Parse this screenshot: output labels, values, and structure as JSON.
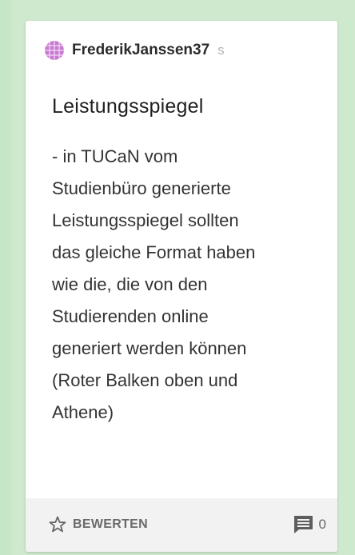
{
  "card": {
    "author": {
      "name": "FrederikJanssen37",
      "suffix": "s",
      "avatar_icon": "avatar-pattern-icon"
    },
    "title": "Leistungsspiegel",
    "body_lines": [
      "- in TUCaN vom",
      "Studienbüro generierte",
      "Leistungsspiegel sollten",
      "das gleiche Format haben",
      "wie die, die von den",
      "Studierenden online",
      "generiert werden können",
      "(Roter Balken oben und",
      "Athene)"
    ],
    "footer": {
      "rate_label": "BEWERTEN",
      "rate_icon": "star-outline-icon",
      "comment_icon": "comment-icon",
      "comment_count": "0"
    }
  },
  "colors": {
    "background": "#cfe9cf",
    "card": "#ffffff",
    "footer": "#f2f2f2",
    "avatar": "#c77ad0"
  }
}
